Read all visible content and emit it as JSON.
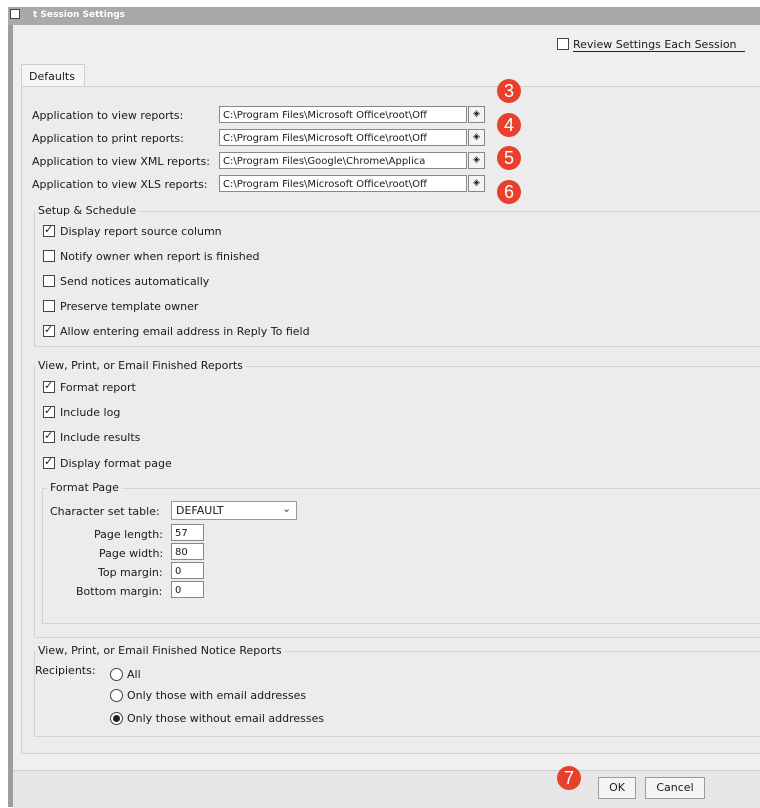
{
  "window": {
    "title": "t Session Settings"
  },
  "review_label": "Review Settings Each Session",
  "tab_label": "Defaults",
  "apps": [
    {
      "label": "Application to view reports:",
      "value": "C:\\Program Files\\Microsoft Office\\root\\Off",
      "marker": "3"
    },
    {
      "label": "Application to print reports:",
      "value": "C:\\Program Files\\Microsoft Office\\root\\Off",
      "marker": "4"
    },
    {
      "label": "Application to view XML reports:",
      "value": "C:\\Program Files\\Google\\Chrome\\Applica",
      "marker": "5"
    },
    {
      "label": "Application to view XLS reports:",
      "value": "C:\\Program Files\\Microsoft Office\\root\\Off",
      "marker": "6"
    }
  ],
  "setup": {
    "title": "Setup & Schedule",
    "items": [
      {
        "label": "Display report source column",
        "checked": true
      },
      {
        "label": "Notify owner when report is finished",
        "checked": false
      },
      {
        "label": "Send notices automatically",
        "checked": false
      },
      {
        "label": "Preserve template owner",
        "checked": false
      },
      {
        "label": "Allow entering email address in Reply To field",
        "checked": true
      }
    ]
  },
  "finished": {
    "title": "View, Print, or Email Finished Reports",
    "items": [
      {
        "label": "Format report",
        "checked": true
      },
      {
        "label": "Include log",
        "checked": true
      },
      {
        "label": "Include results",
        "checked": true
      },
      {
        "label": "Display format page",
        "checked": true
      }
    ],
    "format_page": {
      "title": "Format Page",
      "charset_label": "Character set table:",
      "charset_value": "DEFAULT",
      "fields": [
        {
          "label": "Page length:",
          "value": "57"
        },
        {
          "label": "Page width:",
          "value": "80"
        },
        {
          "label": "Top margin:",
          "value": "0"
        },
        {
          "label": "Bottom margin:",
          "value": "0"
        }
      ]
    }
  },
  "notice": {
    "title": "View, Print, or Email Finished Notice Reports",
    "recipients_label": "Recipients:",
    "options": [
      {
        "label": "All",
        "selected": false
      },
      {
        "label": "Only those with email addresses",
        "selected": false
      },
      {
        "label": "Only those without email addresses",
        "selected": true
      }
    ]
  },
  "footer": {
    "ok_label": "OK",
    "cancel_label": "Cancel",
    "marker": "7"
  },
  "colors": {
    "marker": "#e8402d",
    "titlebar": "#a9a9a9",
    "panel": "#ececec"
  }
}
